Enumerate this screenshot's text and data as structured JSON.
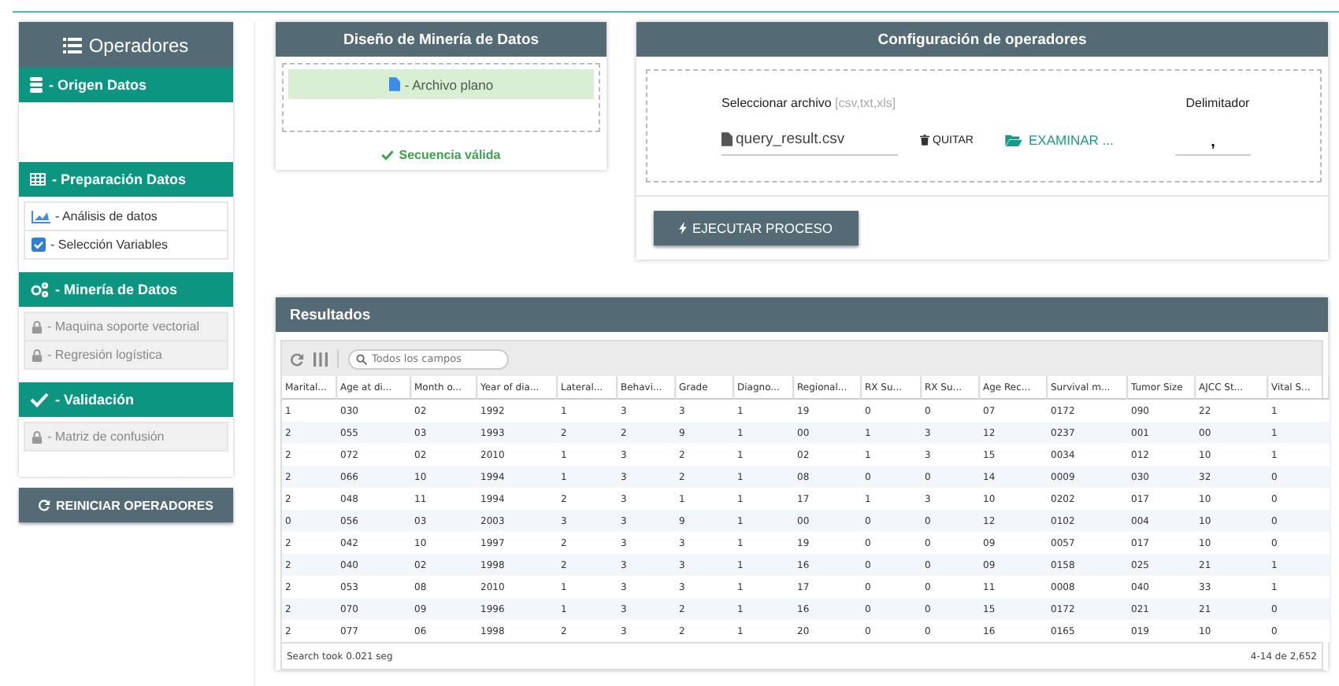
{
  "sidebar": {
    "title": "Operadores",
    "sections": [
      {
        "title": "- Origen Datos"
      },
      {
        "title": "- Preparación Datos",
        "items": [
          {
            "label": "- Análisis de datos",
            "kind": "analysis"
          },
          {
            "label": "- Selección Variables",
            "kind": "selection"
          }
        ]
      },
      {
        "title": "- Minería de Datos",
        "items": [
          {
            "label": "- Maquina soporte vectorial",
            "kind": "locked"
          },
          {
            "label": "- Regresión logística",
            "kind": "locked"
          }
        ]
      },
      {
        "title": "- Validación",
        "items": [
          {
            "label": "- Matriz de confusión",
            "kind": "locked"
          }
        ]
      }
    ],
    "reset_button": "REINICIAR OPERADORES"
  },
  "design": {
    "title": "Diseño de Minería de Datos",
    "node": "- Archivo plano",
    "status": "Secuencia válida"
  },
  "config": {
    "title": "Configuración de operadores",
    "file_label": "Seleccionar archivo",
    "file_hint": "[csv,txt,xls]",
    "file_name": "query_result.csv",
    "remove_button": "QUITAR",
    "browse_button": "EXAMINAR ...",
    "delimiter_label": "Delimitador",
    "delimiter_value": ",",
    "run_button": "EJECUTAR PROCESO"
  },
  "results": {
    "title": "Resultados",
    "search": {
      "placeholder": "Todos los campos"
    },
    "columns": [
      "Marital...",
      "Age at di...",
      "Month o...",
      "Year of dia...",
      "Lateral...",
      "Behavi...",
      "Grade",
      "Diagno...",
      "Regional...",
      "RX Su...",
      "RX Su...",
      "Age Rec...",
      "Survival m...",
      "Tumor Size",
      "AJCC St...",
      "Vital S..."
    ],
    "rows": [
      [
        "1",
        "030",
        "02",
        "1992",
        "1",
        "3",
        "3",
        "1",
        "19",
        "0",
        "0",
        "07",
        "0172",
        "090",
        "22",
        "1"
      ],
      [
        "2",
        "055",
        "03",
        "1993",
        "2",
        "2",
        "9",
        "1",
        "00",
        "1",
        "3",
        "12",
        "0237",
        "001",
        "00",
        "1"
      ],
      [
        "2",
        "072",
        "02",
        "2010",
        "1",
        "3",
        "2",
        "1",
        "02",
        "1",
        "3",
        "15",
        "0034",
        "012",
        "10",
        "1"
      ],
      [
        "2",
        "066",
        "10",
        "1994",
        "1",
        "3",
        "2",
        "1",
        "08",
        "0",
        "0",
        "14",
        "0009",
        "030",
        "32",
        "0"
      ],
      [
        "2",
        "048",
        "11",
        "1994",
        "2",
        "3",
        "1",
        "1",
        "17",
        "1",
        "3",
        "10",
        "0202",
        "017",
        "10",
        "0"
      ],
      [
        "0",
        "056",
        "03",
        "2003",
        "3",
        "3",
        "9",
        "1",
        "00",
        "0",
        "0",
        "12",
        "0102",
        "004",
        "10",
        "0"
      ],
      [
        "2",
        "042",
        "10",
        "1997",
        "2",
        "3",
        "3",
        "1",
        "19",
        "0",
        "0",
        "09",
        "0057",
        "017",
        "10",
        "0"
      ],
      [
        "2",
        "040",
        "02",
        "1998",
        "2",
        "3",
        "3",
        "1",
        "16",
        "0",
        "0",
        "09",
        "0158",
        "025",
        "21",
        "1"
      ],
      [
        "2",
        "053",
        "08",
        "2010",
        "1",
        "3",
        "3",
        "1",
        "17",
        "0",
        "0",
        "11",
        "0008",
        "040",
        "33",
        "1"
      ],
      [
        "2",
        "070",
        "09",
        "1996",
        "1",
        "3",
        "2",
        "1",
        "16",
        "0",
        "0",
        "15",
        "0172",
        "021",
        "21",
        "0"
      ],
      [
        "2",
        "077",
        "06",
        "1998",
        "2",
        "3",
        "2",
        "1",
        "20",
        "0",
        "0",
        "16",
        "0165",
        "019",
        "10",
        "0"
      ]
    ],
    "footer_left": "Search took 0.021 seg",
    "footer_right": "4-14 de 2,652"
  }
}
